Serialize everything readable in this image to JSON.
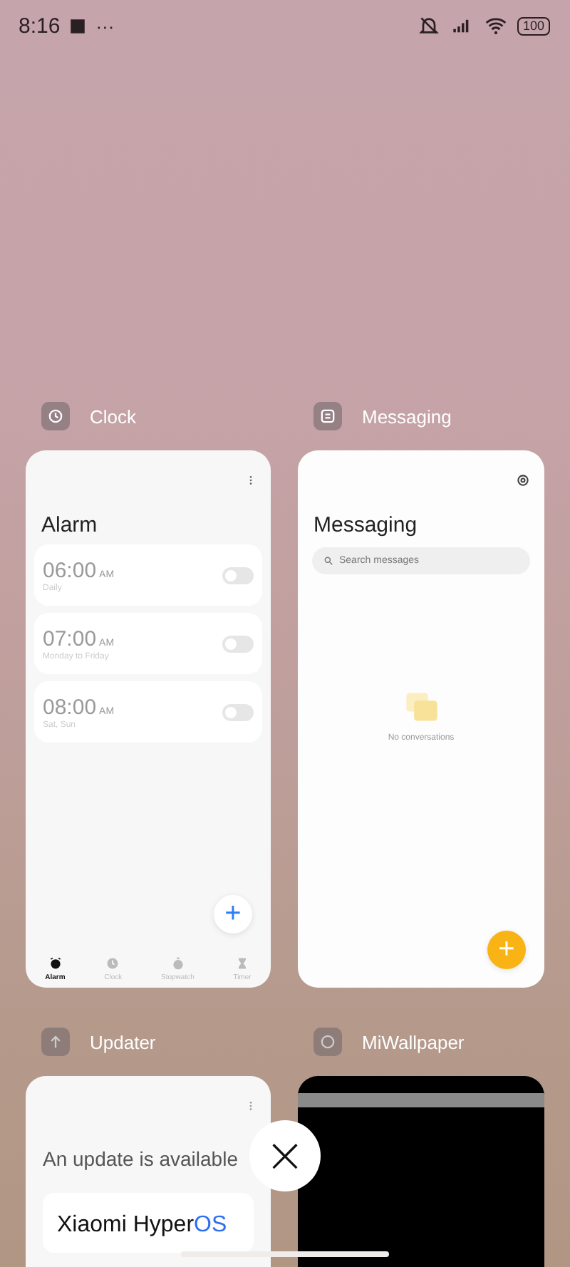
{
  "status_bar": {
    "time": "8:16",
    "more": "···",
    "battery": "100"
  },
  "apps": [
    {
      "kind": "clock",
      "name": "Clock",
      "screen": {
        "title": "Alarm",
        "alarms": [
          {
            "time": "06:00",
            "period": "AM",
            "repeat": "Daily",
            "on": false
          },
          {
            "time": "07:00",
            "period": "AM",
            "repeat": "Monday to Friday",
            "on": false
          },
          {
            "time": "08:00",
            "period": "AM",
            "repeat": "Sat, Sun",
            "on": false
          }
        ],
        "add": "+",
        "tabs": [
          {
            "label": "Alarm",
            "selected": true
          },
          {
            "label": "Clock",
            "selected": false
          },
          {
            "label": "Stopwatch",
            "selected": false
          },
          {
            "label": "Timer",
            "selected": false
          }
        ]
      }
    },
    {
      "kind": "messaging",
      "name": "Messaging",
      "screen": {
        "title": "Messaging",
        "search": {
          "placeholder": "Search messages"
        },
        "empty": "No conversations",
        "add": "+"
      }
    },
    {
      "kind": "updater",
      "name": "Updater",
      "screen": {
        "title": "An update is available",
        "brand": [
          "Xiaomi Hyper",
          "OS"
        ]
      }
    },
    {
      "kind": "wallpaper",
      "name": "MiWallpaper"
    }
  ],
  "close": "×"
}
